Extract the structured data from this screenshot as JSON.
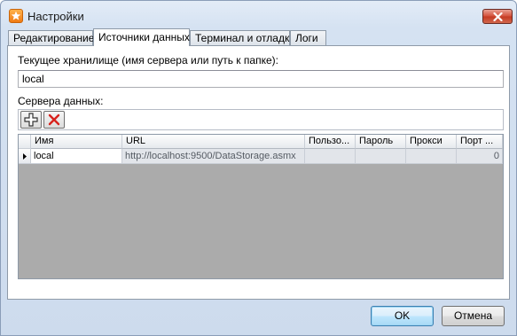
{
  "window": {
    "title": "Настройки",
    "icon": "star-icon"
  },
  "tabs": [
    {
      "label": "Редактирование",
      "active": false
    },
    {
      "label": "Источники данных",
      "active": true
    },
    {
      "label": "Терминал и отладка",
      "active": false
    },
    {
      "label": "Логи",
      "active": false
    }
  ],
  "storage": {
    "label": "Текущее хранилище (имя сервера или путь к папке):",
    "value": "local"
  },
  "servers": {
    "label": "Сервера данных:",
    "toolbar": [
      {
        "name": "add",
        "icon": "plus-icon"
      },
      {
        "name": "delete",
        "icon": "red-x-icon"
      }
    ],
    "columns": [
      "Имя",
      "URL",
      "Пользо...",
      "Пароль",
      "Прокси",
      "Порт ..."
    ],
    "rows": [
      {
        "name": "local",
        "url": "http://localhost:9500/DataStorage.asmx",
        "user": "",
        "password": "",
        "proxy": "",
        "port": "0"
      }
    ]
  },
  "buttons": {
    "ok": "OK",
    "cancel": "Отмена"
  },
  "colors": {
    "close_button": "#c8432a",
    "default_button_border": "#3c7fb1",
    "window_frame": "#cddbed"
  }
}
